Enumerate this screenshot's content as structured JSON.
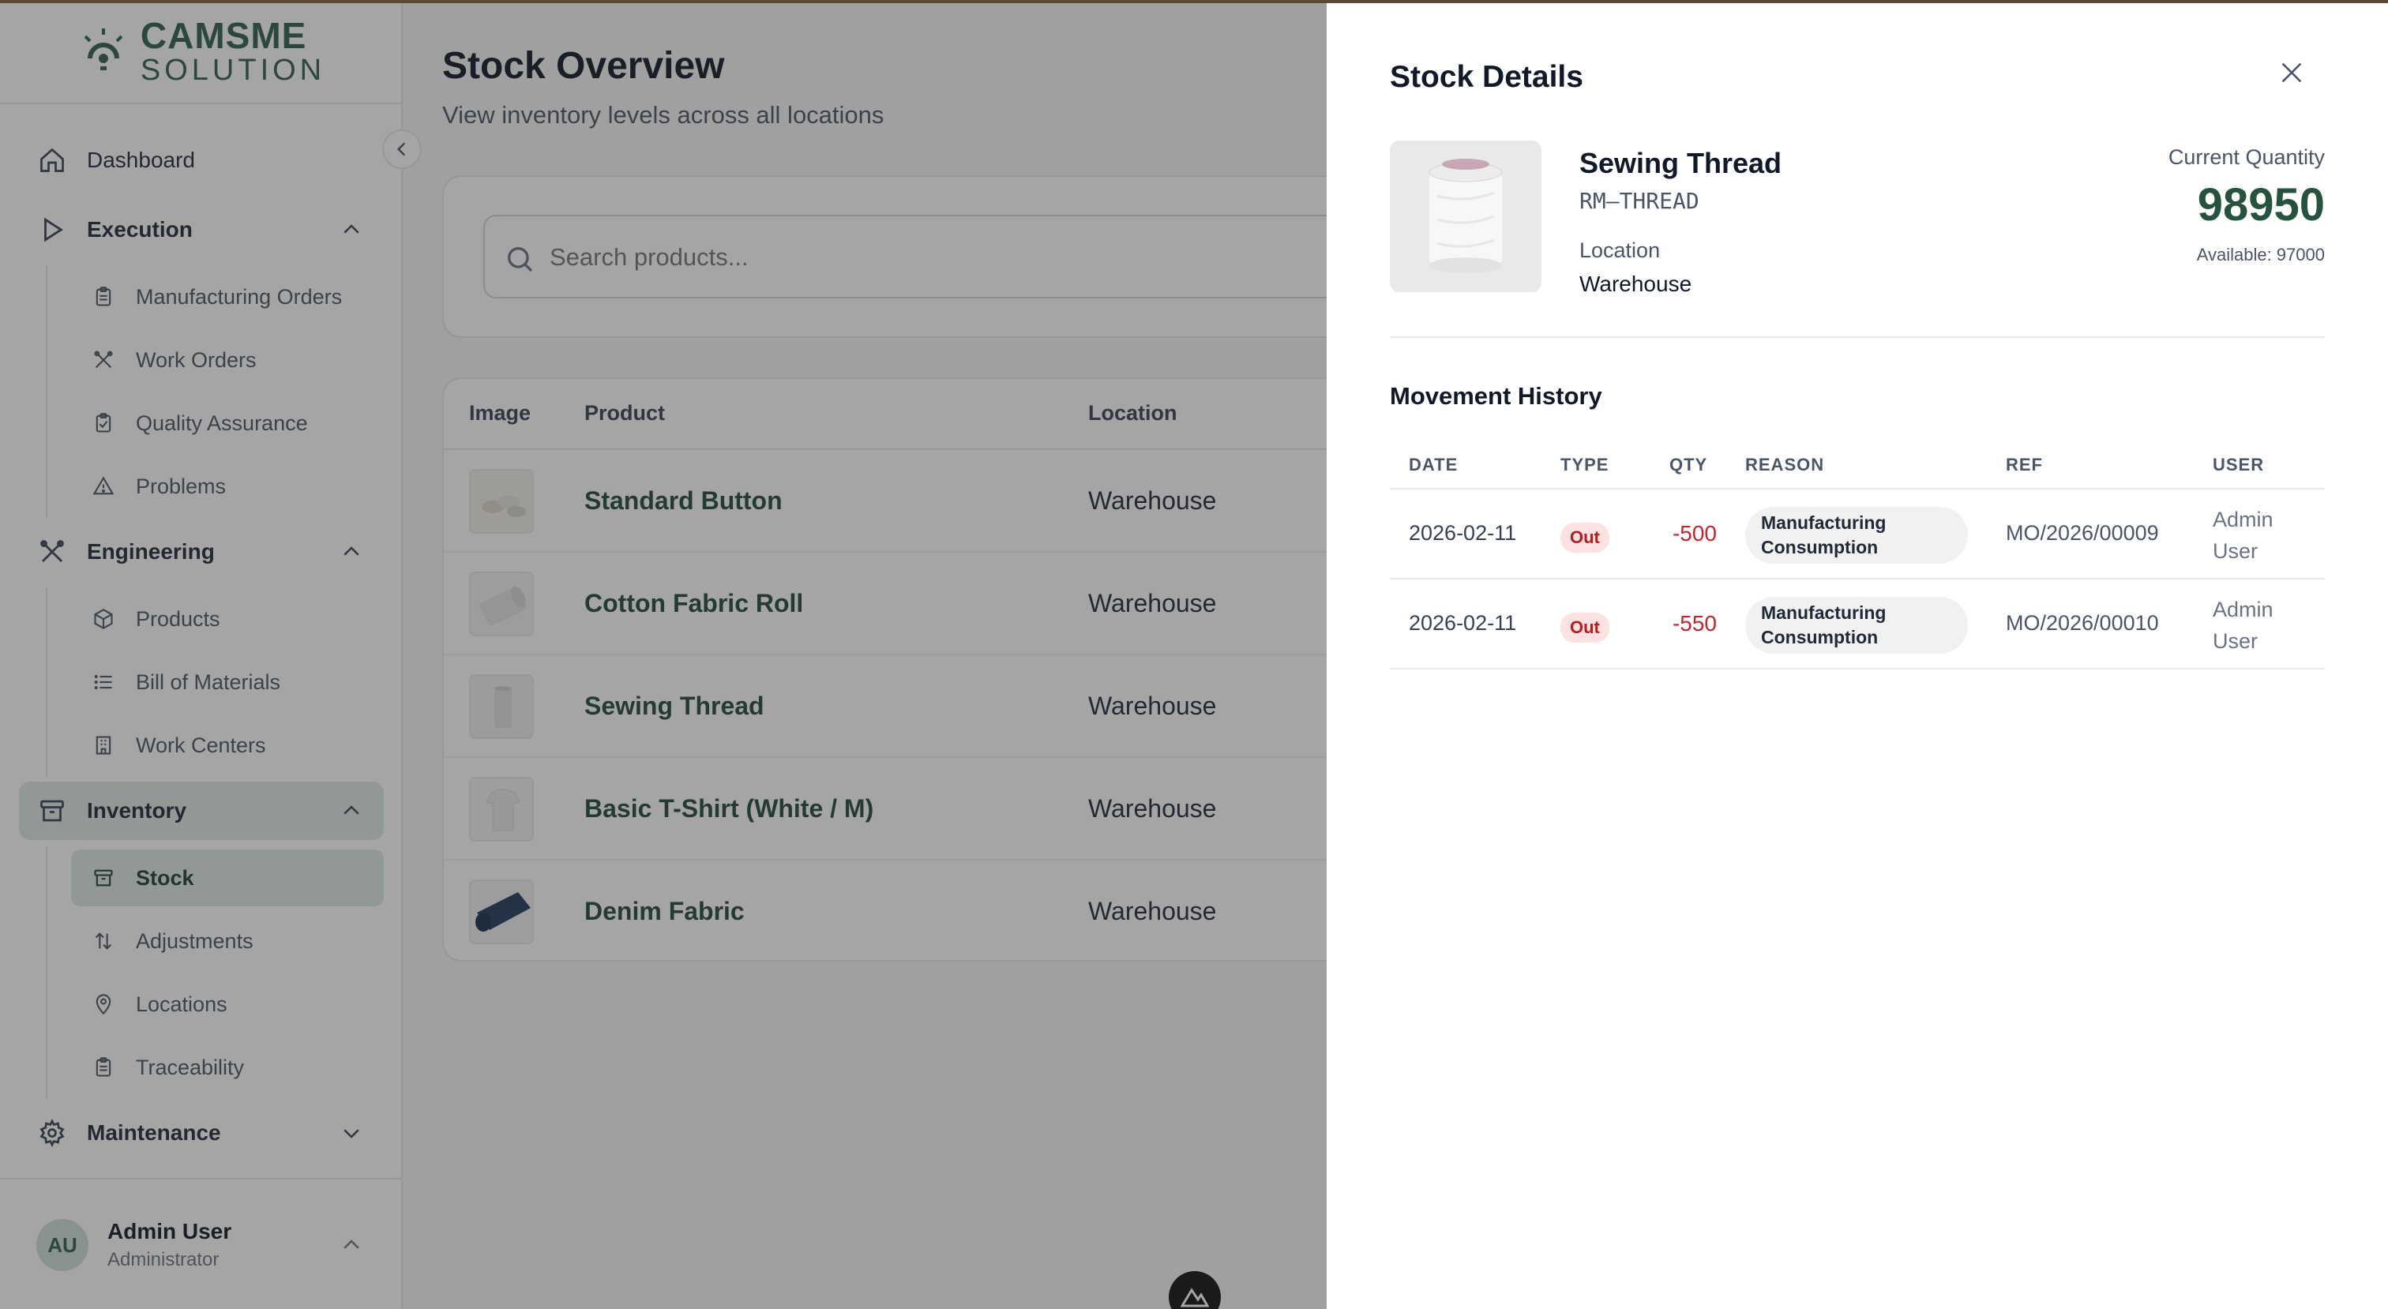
{
  "sidebar": {
    "logo": {
      "line1": "CAMSME",
      "line2": "SOLUTION"
    },
    "nav": {
      "dashboard": "Dashboard",
      "execution": "Execution",
      "manufacturing_orders": "Manufacturing Orders",
      "work_orders": "Work Orders",
      "quality_assurance": "Quality Assurance",
      "problems": "Problems",
      "engineering": "Engineering",
      "products": "Products",
      "bill_of_materials": "Bill of Materials",
      "work_centers": "Work Centers",
      "inventory": "Inventory",
      "stock": "Stock",
      "adjustments": "Adjustments",
      "locations": "Locations",
      "traceability": "Traceability",
      "maintenance": "Maintenance"
    },
    "user": {
      "initials": "AU",
      "name": "Admin User",
      "role": "Administrator"
    }
  },
  "main": {
    "title": "Stock Overview",
    "subtitle": "View inventory levels across all locations",
    "search": {
      "placeholder": "Search products..."
    },
    "table": {
      "headers": {
        "image": "Image",
        "product": "Product",
        "location": "Location"
      },
      "rows": [
        {
          "product": "Standard Button",
          "location": "Warehouse",
          "image": "button-image"
        },
        {
          "product": "Cotton Fabric Roll",
          "location": "Warehouse",
          "image": "fabric-roll-image"
        },
        {
          "product": "Sewing Thread",
          "location": "Warehouse",
          "image": "thread-image"
        },
        {
          "product": "Basic T-Shirt (White / M)",
          "location": "Warehouse",
          "image": "tshirt-image"
        },
        {
          "product": "Denim Fabric",
          "location": "Warehouse",
          "image": "denim-image"
        }
      ]
    }
  },
  "drawer": {
    "title": "Stock Details",
    "product": {
      "name": "Sewing Thread",
      "code": "RM–THREAD",
      "location_label": "Location",
      "location_value": "Warehouse",
      "qty_label": "Current Quantity",
      "qty_value": "98950",
      "available": "Available: 97000"
    },
    "movement_history": {
      "title": "Movement History",
      "headers": {
        "date": "DATE",
        "type": "TYPE",
        "qty": "QTY",
        "reason": "REASON",
        "ref": "REF",
        "user": "USER"
      },
      "rows": [
        {
          "date": "2026-02-11",
          "type": "Out",
          "qty": "-500",
          "reason": "Manufacturing Consumption",
          "ref": "MO/2026/00009",
          "user": "Admin User"
        },
        {
          "date": "2026-02-11",
          "type": "Out",
          "qty": "-550",
          "reason": "Manufacturing Consumption",
          "ref": "MO/2026/00010",
          "user": "Admin User"
        }
      ]
    }
  },
  "colors": {
    "brand": "#2f5d4b",
    "accent_bg": "#dfe8e3",
    "negative": "#c0262d",
    "out_badge_bg": "#fde2e2"
  },
  "icons": [
    "home-icon",
    "play-icon",
    "clipboard-icon",
    "tools-icon",
    "warning-icon",
    "box-icon",
    "list-icon",
    "building-icon",
    "archive-icon",
    "arrows-updown-icon",
    "pin-icon",
    "gear-icon",
    "search-icon",
    "close-icon",
    "chevron-up-icon",
    "chevron-down-icon",
    "chevron-left-icon"
  ]
}
